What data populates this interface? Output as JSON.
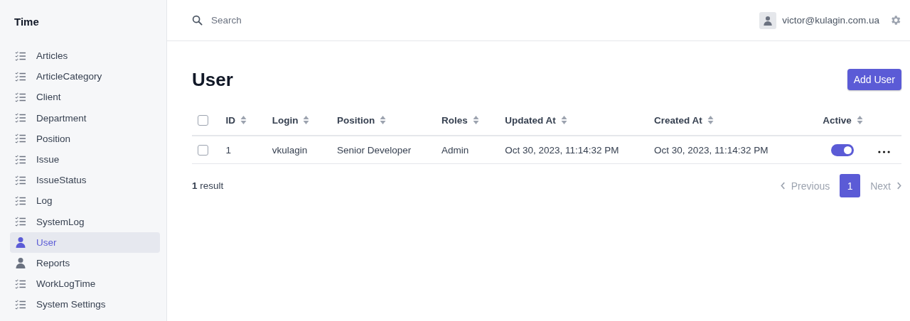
{
  "sidebar": {
    "title": "Time",
    "items": [
      {
        "label": "Articles",
        "kind": "list",
        "selected": false
      },
      {
        "label": "ArticleCategory",
        "kind": "list",
        "selected": false
      },
      {
        "label": "Client",
        "kind": "list",
        "selected": false
      },
      {
        "label": "Department",
        "kind": "list",
        "selected": false
      },
      {
        "label": "Position",
        "kind": "list",
        "selected": false
      },
      {
        "label": "Issue",
        "kind": "list",
        "selected": false
      },
      {
        "label": "IssueStatus",
        "kind": "list",
        "selected": false
      },
      {
        "label": "Log",
        "kind": "list",
        "selected": false
      },
      {
        "label": "SystemLog",
        "kind": "list",
        "selected": false
      },
      {
        "label": "User",
        "kind": "user",
        "selected": true
      },
      {
        "label": "Reports",
        "kind": "user",
        "selected": false
      },
      {
        "label": "WorkLogTime",
        "kind": "list",
        "selected": false
      },
      {
        "label": "System Settings",
        "kind": "list",
        "selected": false
      }
    ]
  },
  "header": {
    "search": {
      "placeholder": "Search"
    },
    "user_email": "victor@kulagin.com.ua"
  },
  "page": {
    "title": "User",
    "add_button": "Add User"
  },
  "table": {
    "all_checked": false,
    "columns": [
      "ID",
      "Login",
      "Position",
      "Roles",
      "Updated At",
      "Created At",
      "Active"
    ],
    "rows": [
      {
        "checked": false,
        "cells": [
          "1",
          "vkulagin",
          "Senior Developer",
          "Admin",
          "Oct 30, 2023, 11:14:32 PM",
          "Oct 30, 2023, 11:14:32 PM"
        ],
        "active": true
      }
    ]
  },
  "footer": {
    "count": "1",
    "count_label": "result",
    "previous": {
      "label": "Previous",
      "disabled": true
    },
    "pages": [
      {
        "label": "1",
        "selected": true
      }
    ],
    "next": {
      "label": "Next",
      "disabled": true
    }
  }
}
